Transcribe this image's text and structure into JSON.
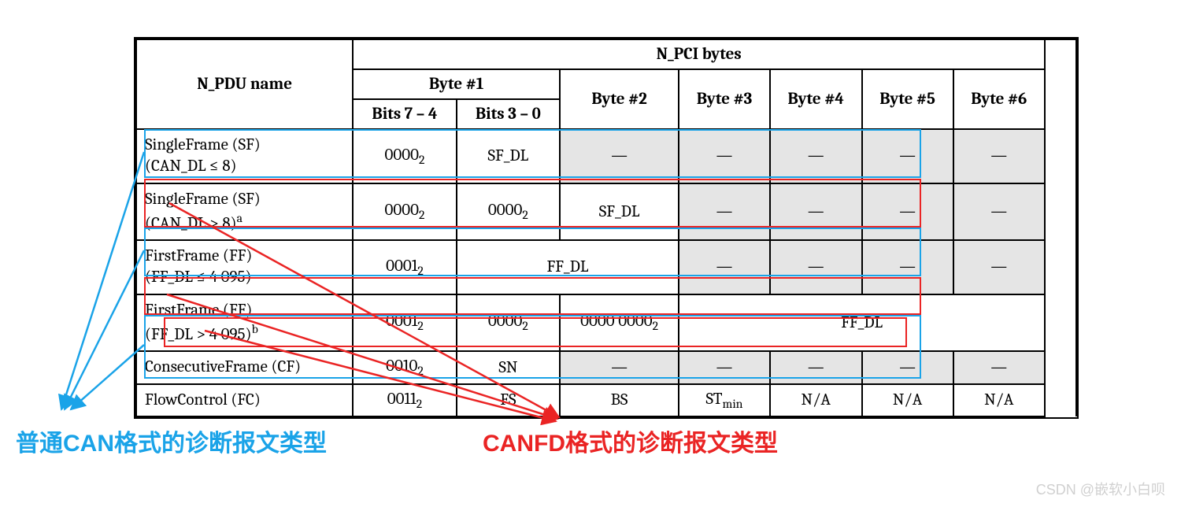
{
  "table": {
    "head_col0": "N_PDU name",
    "head_npci": "N_PCI bytes",
    "head_byte1": "Byte #1",
    "head_bits74": "Bits 7 – 4",
    "head_bits30": "Bits 3 – 0",
    "head_byte2": "Byte #2",
    "head_byte3": "Byte #3",
    "head_byte4": "Byte #4",
    "head_byte5": "Byte #5",
    "head_byte6": "Byte #6",
    "r1_name1": "SingleFrame (SF)",
    "r1_name2": "(CAN_DL ≤ 8)",
    "r1_b74": "0000",
    "r1_b30": "SF_DL",
    "r2_name1": "SingleFrame (SF)",
    "r2_name2": "(CAN_DL > 8)",
    "r2_b74": "0000",
    "r2_b30": "0000",
    "r2_byte2": "SF_DL",
    "r3_name1": "FirstFrame (FF)",
    "r3_name2": "(FF_DL ≤ 4 095)",
    "r3_b74": "0001",
    "r3_ffdl": "FF_DL",
    "r4_name1": "FirstFrame (FF)",
    "r4_name2": "(FF_DL > 4 095)",
    "r4_b74": "0001",
    "r4_b30": "0000",
    "r4_byte2": "0000 0000",
    "r4_ffdl": "FF_DL",
    "r5_name": "ConsecutiveFrame (CF)",
    "r5_b74": "0010",
    "r5_b30": "SN",
    "r6_name": "FlowControl (FC)",
    "r6_b74": "0011",
    "r6_b30": "FS",
    "r6_byte2": "BS",
    "r6_byte3a": "ST",
    "r6_byte3b": "min",
    "r6_na": "N/A",
    "dash": "—",
    "sub2": "2",
    "supa": "a",
    "supb": "b"
  },
  "labels": {
    "blue": "普通CAN格式的诊断报文类型",
    "red": "CANFD格式的诊断报文类型"
  },
  "watermark": "CSDN @嵌软小白呗"
}
